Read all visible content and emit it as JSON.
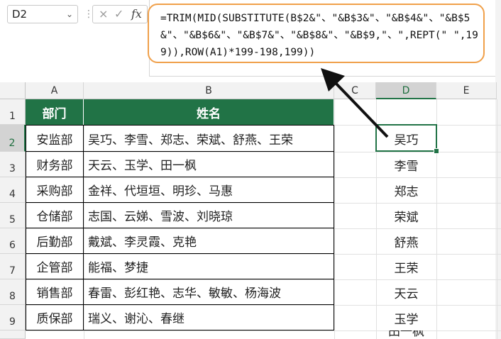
{
  "namebox": {
    "value": "D2"
  },
  "formula_bar": {
    "cancel_icon": "×",
    "confirm_icon": "✓",
    "fx_icon": "fx",
    "formula": "=TRIM(MID(SUBSTITUTE(B$2&\"、\"&B$3&\"、\"&B$4&\"、\"&B$5&\"、\"&B$6&\"、\"&B$7&\"、\"&B$8&\"、\"&B$9,\"、\",REPT(\" \",199)),ROW(A1)*199-198,199))"
  },
  "columns": [
    "A",
    "B",
    "C",
    "D",
    "E"
  ],
  "rows": [
    "1",
    "2",
    "3",
    "4",
    "5",
    "6",
    "7",
    "8",
    "9"
  ],
  "table": {
    "headers": [
      "部门",
      "姓名"
    ],
    "rows": [
      [
        "安监部",
        "吴巧、李雪、郑志、荣斌、舒燕、王荣"
      ],
      [
        "财务部",
        "天云、玉学、田一枫"
      ],
      [
        "采购部",
        "金祥、代垣垣、明珍、马惠"
      ],
      [
        "仓储部",
        "志国、云娣、雪波、刘晓琼"
      ],
      [
        "后勤部",
        "戴斌、李灵霞、克艳"
      ],
      [
        "企管部",
        "能福、梦捷"
      ],
      [
        "销售部",
        "春雷、彭红艳、志华、敏敏、杨海波"
      ],
      [
        "质保部",
        "瑞义、谢沁、春继"
      ]
    ]
  },
  "column_d": [
    "吴巧",
    "李雪",
    "郑志",
    "荣斌",
    "舒燕",
    "王荣",
    "天云",
    "玉学",
    "田一枫"
  ],
  "colors": {
    "accent": "#217346",
    "callout_border": "#f0a04a"
  }
}
